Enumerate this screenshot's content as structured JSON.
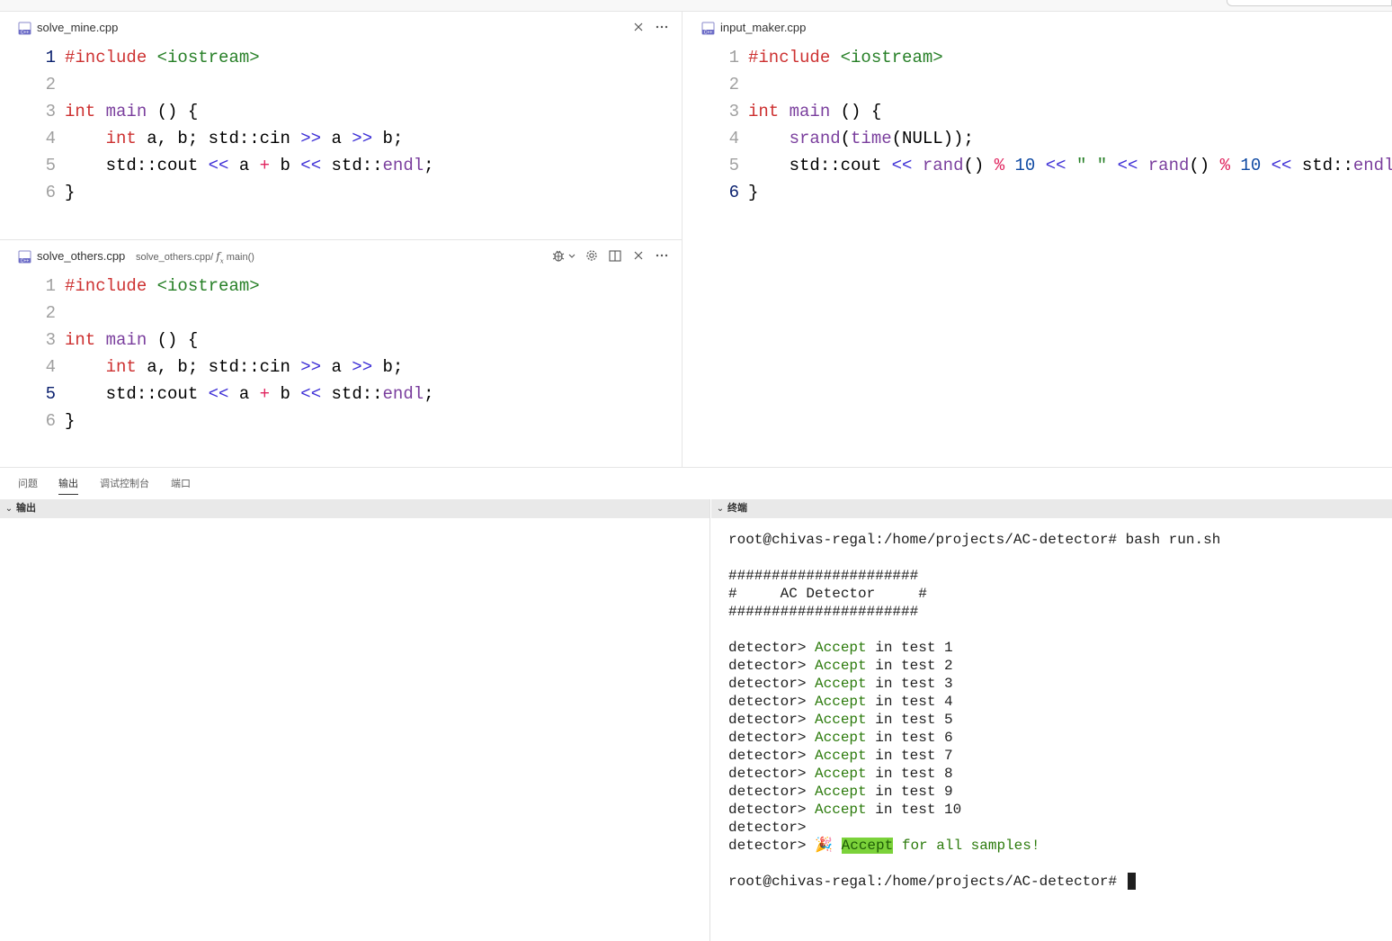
{
  "editors": {
    "mine": {
      "filename": "solve_mine.cpp",
      "current_line": "1"
    },
    "others": {
      "filename": "solve_others.cpp",
      "breadcrumb_file": "solve_others.cpp/",
      "breadcrumb_fx": "fx",
      "breadcrumb_symbol": "main()",
      "current_line": "5"
    },
    "input": {
      "filename": "input_maker.cpp",
      "current_line": "6"
    }
  },
  "code_tokens": {
    "include": "#include",
    "iostream": "<iostream>",
    "int": "int",
    "main": "main",
    "parens_brace": " () {",
    "vars_ab": " a, b; std::cin ",
    "shr": ">>",
    "a": " a ",
    "b_semi": " b;",
    "cout": "std::cout ",
    "shl": "<<",
    "plus": "+",
    "a2": " a ",
    "b2": " b ",
    "std": " std::",
    "endl": "endl",
    "semi": ";",
    "close": "}",
    "srand": "srand",
    "time": "time",
    "null_call": "(NULL));",
    "paren_open": "(",
    "rand": "rand",
    "rand_parens": "() ",
    "mod": "%",
    "ten": "10",
    "space_str": "\" \"",
    "line_numbers": [
      "1",
      "2",
      "3",
      "4",
      "5",
      "6"
    ]
  },
  "panel": {
    "tabs": [
      "问题",
      "输出",
      "调试控制台",
      "端口"
    ],
    "active_tab": "输出",
    "output_header": "输出",
    "terminal_header": "终端"
  },
  "terminal": {
    "prompt_cmd": "root@chivas-regal:/home/projects/AC-detector# bash run.sh",
    "banner": [
      "######################",
      "#     AC Detector     #",
      "######################"
    ],
    "detector_prefix": "detector> ",
    "accept_word": "Accept",
    "tests": [
      " in test 1",
      " in test 2",
      " in test 3",
      " in test 4",
      " in test 5",
      " in test 6",
      " in test 7",
      " in test 8",
      " in test 9",
      " in test 10"
    ],
    "empty_detector": "detector>",
    "final_emoji": "🎉",
    "final_suffix": " for all samples!",
    "final_prompt": "root@chivas-regal:/home/projects/AC-detector# "
  },
  "colors": {
    "keyword": "#af00db",
    "type_keyword": "#cd3131",
    "string": "#267f26",
    "accept_green": "#2b7a0b",
    "accept_highlight": "#7bd23a"
  },
  "icons": [
    "cpp-file-icon",
    "close-icon",
    "more-icon",
    "debug-icon",
    "gear-icon",
    "split-editor-icon",
    "chevron-down-icon"
  ]
}
